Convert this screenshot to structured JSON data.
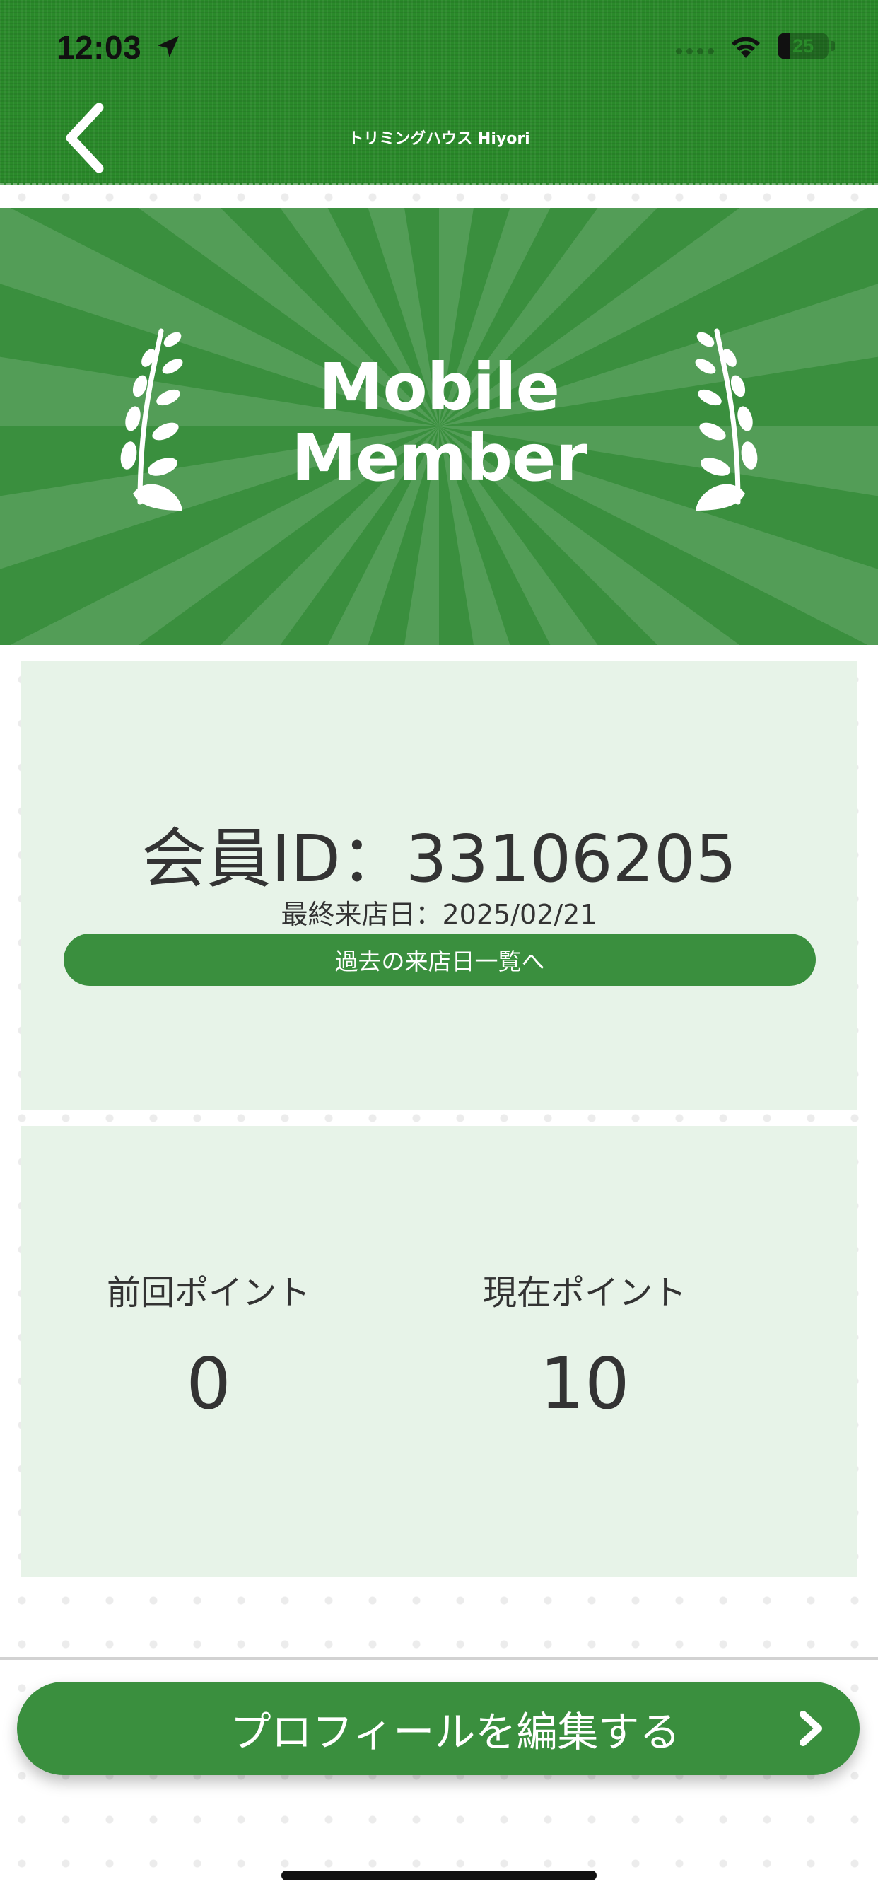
{
  "status_bar": {
    "time": "12:03",
    "battery": "25",
    "battery_level": 0.25
  },
  "header": {
    "title": "トリミングハウス Hiyori",
    "back_icon": "chevron-left-icon"
  },
  "banner": {
    "title_line1": "Mobile",
    "title_line2": "Member",
    "decoration_icon": "laurel-branch-icon"
  },
  "member": {
    "id_text": "会員ID：33106205",
    "last_visit": "最終来店日：2025/02/21",
    "history_button": "過去の来店日一覧へ"
  },
  "points": {
    "previous_label": "前回ポイント",
    "previous_value": "0",
    "current_label": "現在ポイント",
    "current_value": "10"
  },
  "actions": {
    "edit_profile": "プロフィールを編集する",
    "edit_icon": "chevron-right-icon"
  },
  "colors": {
    "brand_green": "#2a8a2a",
    "banner_green": "#3a8f3e",
    "card_background": "#e7f3e8",
    "text": "#333333"
  }
}
